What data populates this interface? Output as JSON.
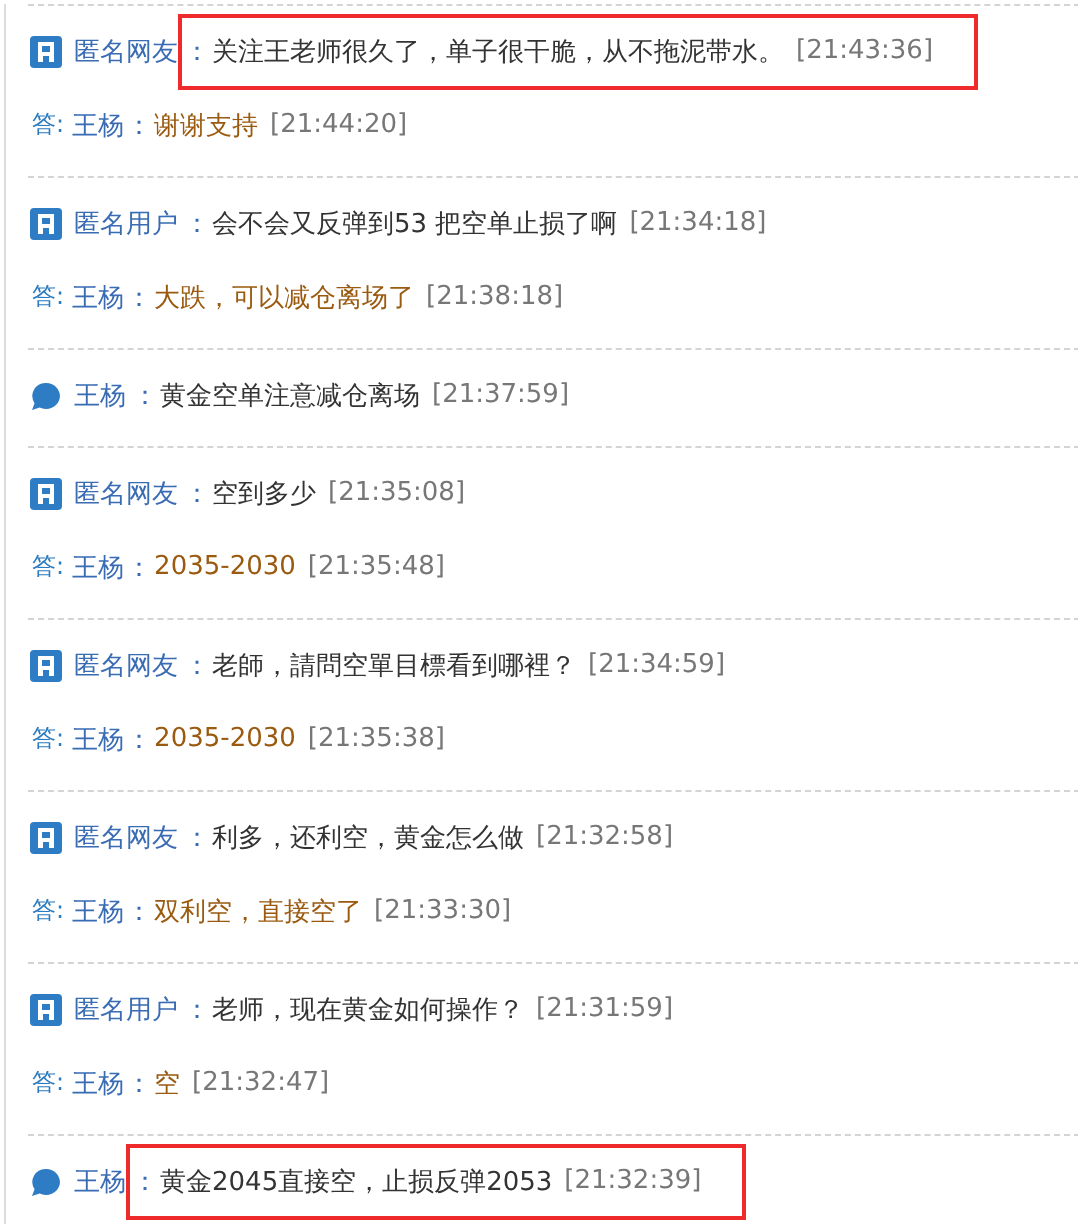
{
  "entries": [
    {
      "kind": "question",
      "author": "匿名网友",
      "sep": "：",
      "message": "关注王老师很久了，单子很干脆，从不拖泥带水。",
      "time": "[21:43:36]",
      "highlighted": true,
      "reply": {
        "label": "答:",
        "author": "王杨",
        "sep": "：",
        "message": "谢谢支持",
        "time": "[21:44:20]"
      }
    },
    {
      "kind": "question",
      "author": "匿名用户",
      "sep": "：",
      "message": "会不会又反弹到53 把空单止损了啊",
      "time": "[21:34:18]",
      "highlighted": false,
      "reply": {
        "label": "答:",
        "author": "王杨",
        "sep": "：",
        "message": "大跌，可以减仓离场了",
        "time": "[21:38:18]"
      }
    },
    {
      "kind": "notice",
      "author": "王杨",
      "sep": "：",
      "message": "黄金空单注意减仓离场",
      "time": "[21:37:59]",
      "highlighted": false
    },
    {
      "kind": "question",
      "author": "匿名网友",
      "sep": "：",
      "message": "空到多少",
      "time": "[21:35:08]",
      "highlighted": false,
      "reply": {
        "label": "答:",
        "author": "王杨",
        "sep": "：",
        "message": "2035-2030",
        "time": "[21:35:48]"
      }
    },
    {
      "kind": "question",
      "author": "匿名网友",
      "sep": "：",
      "message": "老師，請問空單目標看到哪裡？",
      "time": "[21:34:59]",
      "highlighted": false,
      "reply": {
        "label": "答:",
        "author": "王杨",
        "sep": "：",
        "message": "2035-2030",
        "time": "[21:35:38]"
      }
    },
    {
      "kind": "question",
      "author": "匿名网友",
      "sep": "：",
      "message": "利多，还利空，黄金怎么做",
      "time": "[21:32:58]",
      "highlighted": false,
      "reply": {
        "label": "答:",
        "author": "王杨",
        "sep": "：",
        "message": "双利空，直接空了",
        "time": "[21:33:30]"
      }
    },
    {
      "kind": "question",
      "author": "匿名用户",
      "sep": "：",
      "message": "老师，现在黄金如何操作？",
      "time": "[21:31:59]",
      "highlighted": false,
      "reply": {
        "label": "答:",
        "author": "王杨",
        "sep": "：",
        "message": "空",
        "time": "[21:32:47]"
      }
    },
    {
      "kind": "notice",
      "author": "王杨",
      "sep": "：",
      "message": "黄金2045直接空，止损反弹2053",
      "time": "[21:32:39]",
      "highlighted": true
    }
  ]
}
